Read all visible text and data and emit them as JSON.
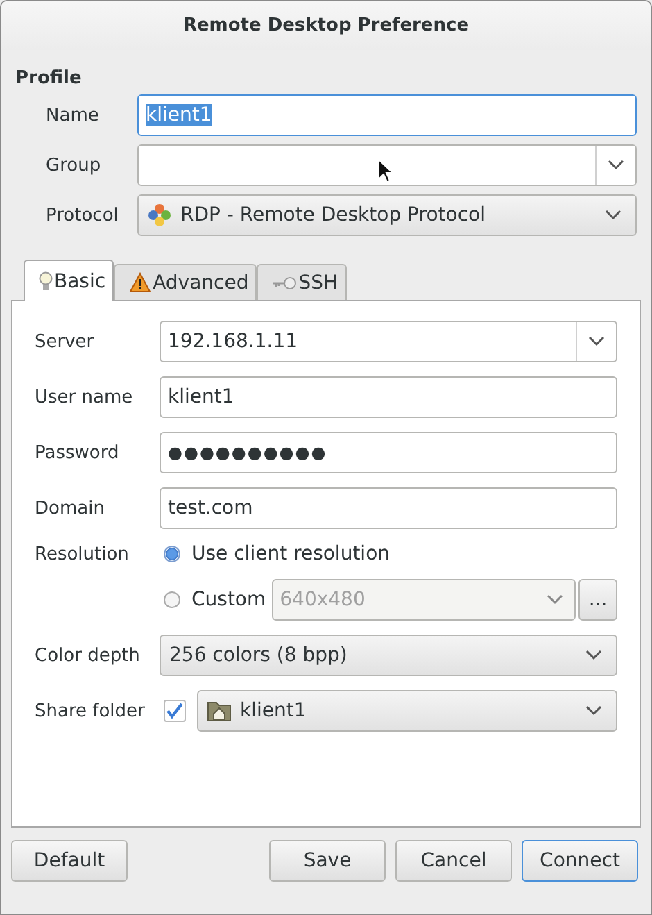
{
  "window": {
    "title": "Remote Desktop Preference"
  },
  "profile": {
    "heading": "Profile",
    "name": {
      "label": "Name",
      "value": "klient1",
      "text_selected": true
    },
    "group": {
      "label": "Group"
    },
    "protocol": {
      "label": "Protocol",
      "value": "RDP - Remote Desktop Protocol"
    }
  },
  "tabs": [
    {
      "label": "Basic",
      "kind": "bulb",
      "selected": true
    },
    {
      "label": "Advanced",
      "kind": "warning",
      "selected": false
    },
    {
      "label": "SSH",
      "kind": "key",
      "selected": false
    }
  ],
  "basic": {
    "server": {
      "label": "Server",
      "value": "192.168.1.11"
    },
    "user_name": {
      "label": "User name",
      "value": "klient1"
    },
    "password": {
      "label": "Password",
      "value": "●●●●●●●●●●"
    },
    "domain": {
      "label": "Domain",
      "value": "test.com"
    },
    "resolution": {
      "label": "Resolution",
      "options": [
        {
          "label": "Use client resolution",
          "selected": true
        },
        {
          "label": "Custom",
          "selected": false,
          "value": "640x480",
          "more": "..."
        }
      ]
    },
    "color_depth": {
      "label": "Color depth",
      "value": "256 colors (8 bpp)"
    },
    "share_folder": {
      "label": "Share folder",
      "checked": true,
      "value": "klient1"
    }
  },
  "buttons": [
    {
      "label": "Default",
      "focused": false
    },
    {
      "label": "Save",
      "focused": false
    },
    {
      "label": "Cancel",
      "focused": false
    },
    {
      "label": "Connect",
      "focused": true
    }
  ]
}
